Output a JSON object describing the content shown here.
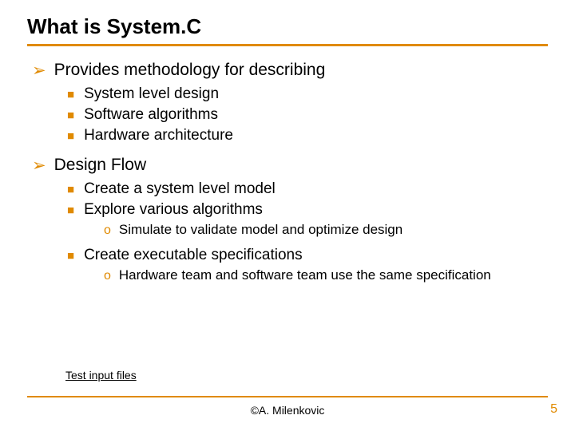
{
  "title": "What is System.C",
  "items": [
    {
      "level": 1,
      "text": "Provides methodology for describing"
    },
    {
      "level": 2,
      "text": "System level design"
    },
    {
      "level": 2,
      "text": "Software algorithms"
    },
    {
      "level": 2,
      "text": "Hardware architecture"
    },
    {
      "level": 1,
      "text": "Design Flow"
    },
    {
      "level": 2,
      "text": "Create a system level model"
    },
    {
      "level": 2,
      "text": "Explore various algorithms"
    },
    {
      "level": 3,
      "text": "Simulate to validate model and optimize design"
    },
    {
      "level": 2,
      "text": "Create executable specifications"
    },
    {
      "level": 3,
      "text": "Hardware team and software team use the same specification"
    }
  ],
  "footer": {
    "link_text": "Test input files",
    "author": "©A. Milenkovic",
    "page_number": "5"
  },
  "colors": {
    "accent": "#e08a00"
  }
}
